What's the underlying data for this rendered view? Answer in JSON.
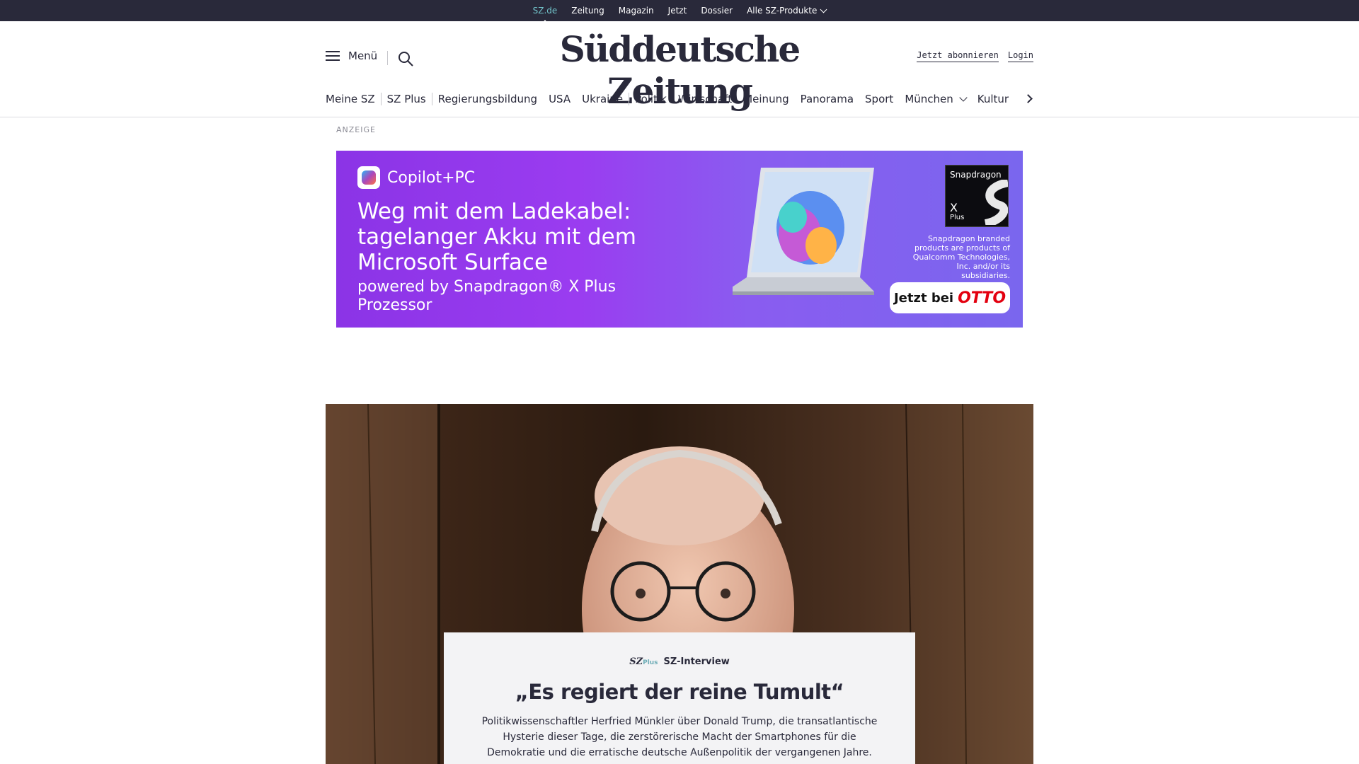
{
  "topbar": {
    "items": [
      "SZ.de",
      "Zeitung",
      "Magazin",
      "Jetzt",
      "Dossier",
      "Alle SZ-Produkte"
    ]
  },
  "header": {
    "menu_label": "Menü",
    "logo": "Süddeutsche Zeitung",
    "subscribe_label": "Jetzt abonnieren",
    "login_label": "Login"
  },
  "sections": [
    "Meine SZ",
    "SZ Plus",
    "Regierungsbildung",
    "USA",
    "Ukraine",
    "Politik",
    "Wirtschaft",
    "Meinung",
    "Panorama",
    "Sport",
    "München",
    "Kultur"
  ],
  "ad": {
    "label": "ANZEIGE",
    "brand": "Copilot+PC",
    "headline": "Weg mit dem Ladekabel: tagelanger Akku mit dem Microsoft Surface",
    "sub": "powered by Snapdragon® X Plus Prozessor",
    "snap_title": "Snapdragon",
    "snap_x": "X",
    "snap_plus": "Plus",
    "snap_note": "Snapdragon branded products are products of Qualcomm Technologies, Inc. and/or its subsidiaries.",
    "cta_prefix": "Jetzt bei",
    "cta_brand": "OTTO"
  },
  "article": {
    "brand": "SZ",
    "brand_plus": "Plus",
    "kicker": "SZ-Interview",
    "headline": "„Es regiert der reine Tumult“",
    "teaser": "Politikwissenschaftler Herfried Münkler über Donald Trump, die transatlantische Hysterie dieser Tage, die zerstörerische Macht der Smartphones für die Demokratie und die erratische deutsche Außenpolitik der vergangenen Jahre."
  },
  "colors": {
    "topbar": "#29293a",
    "active_nav": "#71c2c9",
    "ad_purple": "#8b34e6",
    "otto_red": "#e3000f"
  }
}
